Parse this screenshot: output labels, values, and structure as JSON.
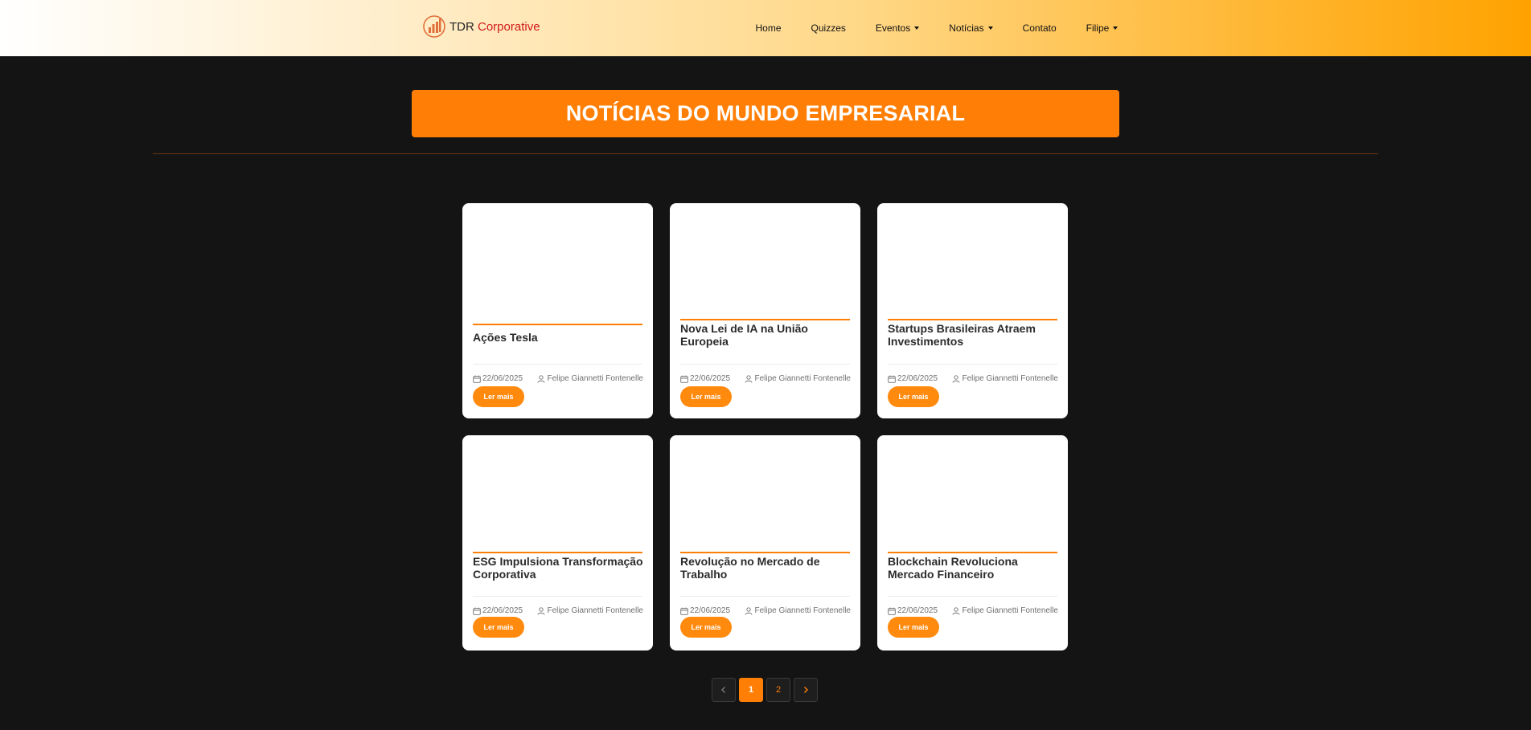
{
  "navbar": {
    "brand": {
      "name": "TDR",
      "accent": "Corporative"
    },
    "items": [
      {
        "label": "Home",
        "has_dropdown": false
      },
      {
        "label": "Quizzes",
        "has_dropdown": false
      },
      {
        "label": "Eventos",
        "has_dropdown": true
      },
      {
        "label": "Notícias",
        "has_dropdown": true
      },
      {
        "label": "Contato",
        "has_dropdown": false
      },
      {
        "label": "Filipe",
        "has_dropdown": true
      }
    ]
  },
  "page": {
    "title": "NOTÍCIAS DO MUNDO EMPRESARIAL"
  },
  "cards": [
    {
      "title": "Ações Tesla",
      "date": "22/06/2025",
      "author": "Felipe Giannetti Fontenelle",
      "button": "Ler mais"
    },
    {
      "title": "Nova Lei de IA na União Europeia",
      "date": "22/06/2025",
      "author": "Felipe Giannetti Fontenelle",
      "button": "Ler mais"
    },
    {
      "title": "Startups Brasileiras Atraem Investimentos",
      "date": "22/06/2025",
      "author": "Felipe Giannetti Fontenelle",
      "button": "Ler mais"
    },
    {
      "title": "ESG Impulsiona Transformação Corporativa",
      "date": "22/06/2025",
      "author": "Felipe Giannetti Fontenelle",
      "button": "Ler mais"
    },
    {
      "title": "Revolução no Mercado de Trabalho",
      "date": "22/06/2025",
      "author": "Felipe Giannetti Fontenelle",
      "button": "Ler mais"
    },
    {
      "title": "Blockchain Revoluciona Mercado Financeiro",
      "date": "22/06/2025",
      "author": "Felipe Giannetti Fontenelle",
      "button": "Ler mais"
    }
  ],
  "pagination": {
    "pages": [
      "1",
      "2"
    ],
    "current": "1",
    "prev_icon": "chevron-left-icon",
    "next_icon": "chevron-right-icon"
  },
  "colors": {
    "accent": "#ff7f06",
    "button": "#ff8a0d",
    "background": "#141414",
    "brand_accent": "#d21a1a"
  }
}
